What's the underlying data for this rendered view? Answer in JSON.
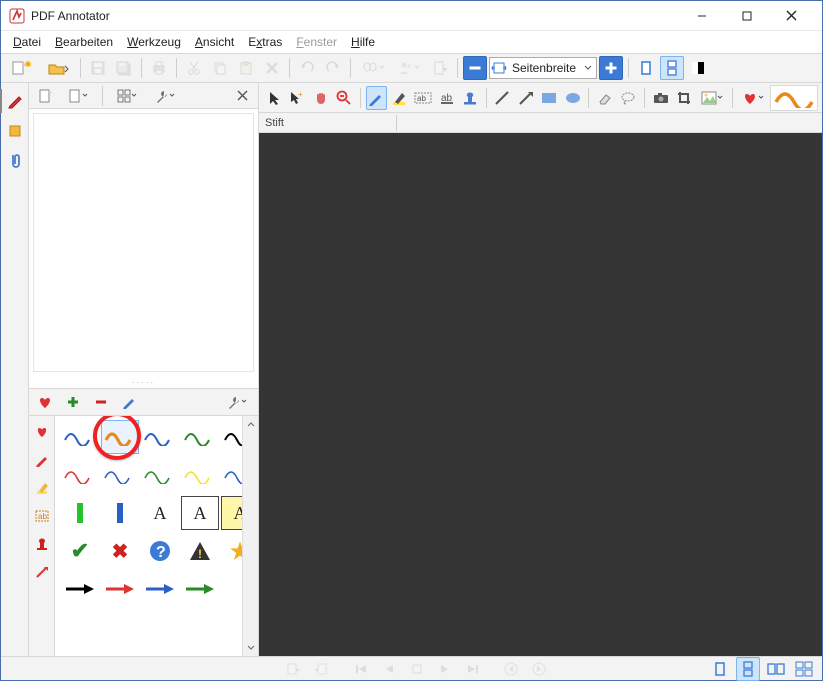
{
  "app": {
    "title": "PDF Annotator"
  },
  "menu": {
    "file": "Datei",
    "edit": "Bearbeiten",
    "tool": "Werkzeug",
    "view": "Ansicht",
    "extras": "Extras",
    "window": "Fenster",
    "help": "Hilfe"
  },
  "zoom": {
    "label": "Seitenbreite"
  },
  "tool_label": {
    "pen": "Stift"
  },
  "split_handle": "·····",
  "letters": {
    "A1": "A",
    "A2": "A",
    "A3": "A"
  },
  "marks": {
    "check": "✔",
    "cross": "✖",
    "question": "?",
    "warn": "!",
    "star": "★"
  },
  "icons": {
    "minimize": "minimize-icon",
    "maximize": "maximize-icon",
    "close": "close-icon",
    "new_doc": "new-document-icon",
    "open": "open-icon",
    "save": "save-icon",
    "save_all": "save-all-icon",
    "print": "print-icon",
    "cut": "cut-icon",
    "copy": "copy-icon",
    "paste": "paste-icon",
    "delete": "delete-icon",
    "undo": "undo-icon",
    "redo": "redo-icon",
    "find": "binoculars-icon",
    "people": "people-icon",
    "goto": "goto-page-icon",
    "zoom_out": "zoom-out-icon",
    "fit_width": "fit-width-icon",
    "zoom_in": "zoom-in-icon",
    "single_page": "single-page-icon",
    "continuous": "continuous-page-icon",
    "dark_mode": "dark-contrast-icon",
    "doc_blank": "blank-document-icon",
    "doc_new": "new-page-icon",
    "thumbnails": "thumbnails-icon",
    "wrench": "wrench-icon",
    "close_tab": "close-tab-icon",
    "heart": "heart-icon",
    "plus": "plus-icon",
    "minus": "minus-icon",
    "pen": "pen-icon",
    "cursor": "cursor-icon",
    "cursor_plus": "cursor-plus-icon",
    "hand": "hand-pan-icon",
    "zoom_out_tool": "zoom-out-tool-icon",
    "highlighter": "highlighter-icon",
    "text_box": "text-box-icon",
    "text_underline": "text-underline-icon",
    "stamp": "stamp-icon",
    "line": "line-icon",
    "arrow_tool": "arrow-tool-icon",
    "rect": "rectangle-icon",
    "ellipse": "ellipse-icon",
    "eraser": "eraser-icon",
    "lasso": "lasso-icon",
    "camera": "camera-icon",
    "crop": "crop-icon",
    "image": "image-icon",
    "chevron_down": "chevron-down-icon",
    "nav_first": "nav-first-icon",
    "nav_prev": "nav-prev-icon",
    "nav_stop": "nav-stop-icon",
    "nav_next": "nav-next-icon",
    "nav_last": "nav-last-icon",
    "nav_back": "nav-back-icon",
    "nav_fwd": "nav-forward-icon",
    "layout1": "layout-single-icon",
    "layout2": "layout-single-continuous-icon",
    "layout3": "layout-two-up-icon",
    "layout4": "layout-two-up-continuous-icon",
    "pen_side": "pen-side-icon",
    "note": "note-side-icon",
    "clip": "paperclip-icon",
    "pen_red": "pen-red-icon",
    "highlighter_side": "highlighter-side-icon",
    "text_side": "text-side-icon",
    "stamp_side": "stamp-side-icon",
    "arrow_side": "arrow-side-icon"
  }
}
